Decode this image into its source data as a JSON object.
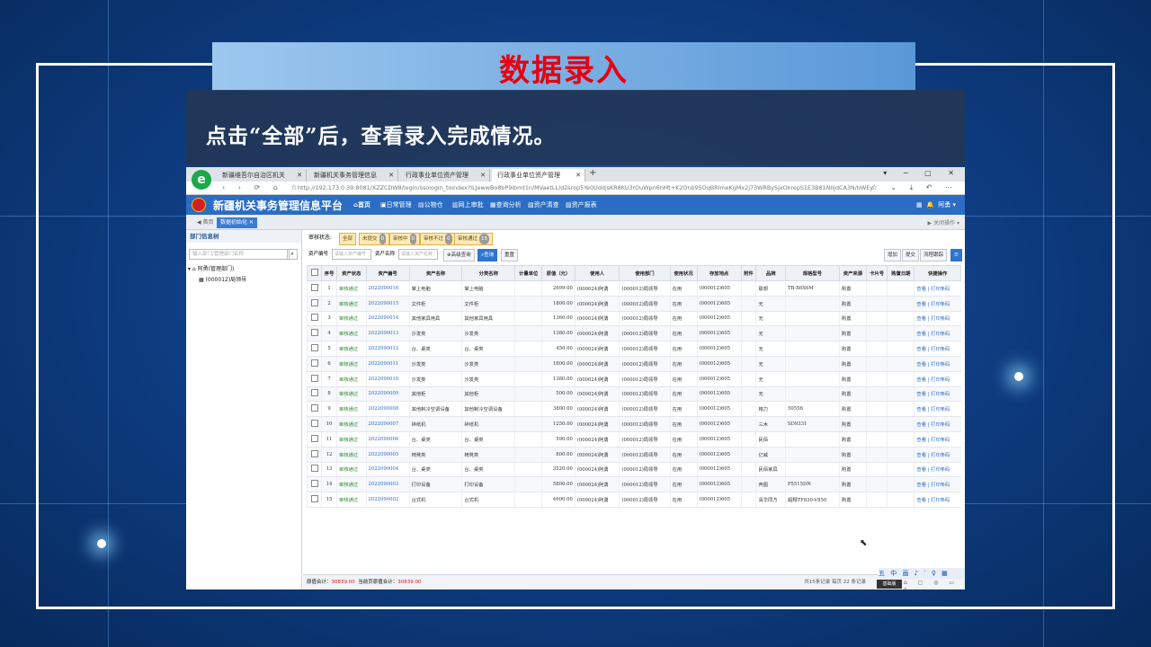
{
  "slide": {
    "banner_title": "数据录入",
    "caption": "点击“全部”后，查看录入完成情况。"
  },
  "browser": {
    "tabs": [
      {
        "label": "新疆维吾尔自治区机关"
      },
      {
        "label": "新疆机关事务管理信息"
      },
      {
        "label": "行政事业单位资产管理"
      },
      {
        "label": "行政事业单位资产管理"
      }
    ],
    "url": "http://192.173.0.39:8081/XZZCDW8/login/ssologin_toindex?ILJewwBo8bP9ibmt1n/MVaetLL/d2srop5Ye0UddjsKR8KU3rOuWpn6hMt+K2Onb95OqBRImeKgMx2j73WRBySjxOkrepS1E3B81NIIjdCA3N/bWEygAnOw=="
  },
  "app": {
    "title": "新疆机关事务管理信息平台",
    "menu": [
      "首页",
      "日常管理",
      "公物仓",
      "网上审批",
      "查询分析",
      "资产清查",
      "资产报表"
    ],
    "user": "阿勇",
    "page_tabs": {
      "home": "首页",
      "current": "数据初始化"
    },
    "page_tabs_right": "关闭操作"
  },
  "left_pane": {
    "title": "部门信息树",
    "search_placeholder": "输入部门/管理部门名称",
    "tree_root": "阿勇(管理部门)",
    "tree_child": "(000012)局领导"
  },
  "filters": {
    "status_label": "审核状态:",
    "chips": [
      {
        "label": "全部",
        "count": ""
      },
      {
        "label": "未提交",
        "count": "0"
      },
      {
        "label": "审核中",
        "count": "0"
      },
      {
        "label": "审核不过",
        "count": "0"
      },
      {
        "label": "审核通过",
        "count": "15"
      }
    ],
    "asset_no_label": "资产编号",
    "asset_no_placeholder": "请输入资产编号",
    "asset_name_label": "资产名称",
    "asset_name_placeholder": "请输入资产名称",
    "adv_query": "高级查询",
    "query": "查询",
    "reset": "重置",
    "right_buttons": [
      "增加",
      "提交",
      "流程跟踪"
    ]
  },
  "table": {
    "headers": [
      "序号",
      "资产状态",
      "资产编号",
      "资产名称",
      "分类名称",
      "计量单位",
      "原值（元）",
      "使用人",
      "使用部门",
      "使用状况",
      "存放地点",
      "附件",
      "品牌",
      "规格型号",
      "资产来源",
      "卡片号",
      "购置日期",
      "快捷操作"
    ],
    "rows": [
      {
        "no": "1",
        "status": "审核通过",
        "code": "2022090016",
        "name": "掌上电脑",
        "cat": "掌上电脑",
        "unit": "",
        "value": "2699.00",
        "user": "(000024)阿勇",
        "dept": "(000012)局领导",
        "cond": "在用",
        "place": "(000012)605",
        "att": "",
        "brand": "联想",
        "model": "TB-X6X6M",
        "src": "购置",
        "card": "",
        "date": "",
        "ops": "查看 | 打印条码"
      },
      {
        "no": "2",
        "status": "审核通过",
        "code": "2022090015",
        "name": "文件柜",
        "cat": "文件柜",
        "unit": "",
        "value": "1800.00",
        "user": "(000024)阿勇",
        "dept": "(000012)局领导",
        "cond": "在用",
        "place": "(000012)605",
        "att": "",
        "brand": "无",
        "model": "",
        "src": "购置",
        "card": "",
        "date": "",
        "ops": "查看 | 打印条码"
      },
      {
        "no": "3",
        "status": "审核通过",
        "code": "2022090014",
        "name": "其他家具用具",
        "cat": "其他家具用具",
        "unit": "",
        "value": "1360.00",
        "user": "(000024)阿勇",
        "dept": "(000012)局领导",
        "cond": "在用",
        "place": "(000012)605",
        "att": "",
        "brand": "无",
        "model": "",
        "src": "购置",
        "card": "",
        "date": "",
        "ops": "查看 | 打印条码"
      },
      {
        "no": "4",
        "status": "审核通过",
        "code": "2022090013",
        "name": "沙发类",
        "cat": "沙发类",
        "unit": "",
        "value": "1380.00",
        "user": "(000024)阿勇",
        "dept": "(000012)局领导",
        "cond": "在用",
        "place": "(000012)605",
        "att": "",
        "brand": "无",
        "model": "",
        "src": "购置",
        "card": "",
        "date": "",
        "ops": "查看 | 打印条码"
      },
      {
        "no": "5",
        "status": "审核通过",
        "code": "2022090012",
        "name": "台、桌类",
        "cat": "台、桌类",
        "unit": "",
        "value": "450.00",
        "user": "(000024)阿勇",
        "dept": "(000012)局领导",
        "cond": "在用",
        "place": "(000012)605",
        "att": "",
        "brand": "无",
        "model": "",
        "src": "购置",
        "card": "",
        "date": "",
        "ops": "查看 | 打印条码"
      },
      {
        "no": "6",
        "status": "审核通过",
        "code": "2022090011",
        "name": "沙发类",
        "cat": "沙发类",
        "unit": "",
        "value": "1800.00",
        "user": "(000024)阿勇",
        "dept": "(000012)局领导",
        "cond": "在用",
        "place": "(000012)605",
        "att": "",
        "brand": "无",
        "model": "",
        "src": "购置",
        "card": "",
        "date": "",
        "ops": "查看 | 打印条码"
      },
      {
        "no": "7",
        "status": "审核通过",
        "code": "2022090010",
        "name": "沙发类",
        "cat": "沙发类",
        "unit": "",
        "value": "1380.00",
        "user": "(000024)阿勇",
        "dept": "(000012)局领导",
        "cond": "在用",
        "place": "(000012)605",
        "att": "",
        "brand": "无",
        "model": "",
        "src": "购置",
        "card": "",
        "date": "",
        "ops": "查看 | 打印条码"
      },
      {
        "no": "8",
        "status": "审核通过",
        "code": "2022090009",
        "name": "其他柜",
        "cat": "其他柜",
        "unit": "",
        "value": "500.00",
        "user": "(000024)阿勇",
        "dept": "(000012)局领导",
        "cond": "在用",
        "place": "(000012)605",
        "att": "",
        "brand": "无",
        "model": "",
        "src": "购置",
        "card": "",
        "date": "",
        "ops": "查看 | 打印条码"
      },
      {
        "no": "9",
        "status": "审核通过",
        "code": "2022090008",
        "name": "其他制冷空调设备",
        "cat": "其他制冷空调设备",
        "unit": "",
        "value": "3800.00",
        "user": "(000024)阿勇",
        "dept": "(000012)局领导",
        "cond": "在用",
        "place": "(000012)605",
        "att": "",
        "brand": "格力",
        "model": "50556",
        "src": "购置",
        "card": "",
        "date": "",
        "ops": "查看 | 打印条码"
      },
      {
        "no": "10",
        "status": "审核通过",
        "code": "2022090007",
        "name": "碎纸机",
        "cat": "碎纸机",
        "unit": "",
        "value": "1250.00",
        "user": "(000024)阿勇",
        "dept": "(000012)局领导",
        "cond": "在用",
        "place": "(000012)605",
        "att": "",
        "brand": "三木",
        "model": "SD9331",
        "src": "购置",
        "card": "",
        "date": "",
        "ops": "查看 | 打印条码"
      },
      {
        "no": "11",
        "status": "审核通过",
        "code": "2022090006",
        "name": "台、桌类",
        "cat": "台、桌类",
        "unit": "",
        "value": "590.00",
        "user": "(000024)阿勇",
        "dept": "(000012)局领导",
        "cond": "在用",
        "place": "(000012)605",
        "att": "",
        "brand": "民佰",
        "model": "",
        "src": "购置",
        "card": "",
        "date": "",
        "ops": "查看 | 打印条码"
      },
      {
        "no": "12",
        "status": "审核通过",
        "code": "2022090005",
        "name": "椅凳类",
        "cat": "椅凳类",
        "unit": "",
        "value": "800.00",
        "user": "(000024)阿勇",
        "dept": "(000012)局领导",
        "cond": "在用",
        "place": "(000012)605",
        "att": "",
        "brand": "亿威",
        "model": "",
        "src": "购置",
        "card": "",
        "date": "",
        "ops": "查看 | 打印条码"
      },
      {
        "no": "13",
        "status": "审核通过",
        "code": "2022090004",
        "name": "台、桌类",
        "cat": "台、桌类",
        "unit": "",
        "value": "3520.00",
        "user": "(000024)阿勇",
        "dept": "(000012)局领导",
        "cond": "在用",
        "place": "(000012)605",
        "att": "",
        "brand": "民佰家具",
        "model": "",
        "src": "购置",
        "card": "",
        "date": "",
        "ops": "查看 | 打印条码"
      },
      {
        "no": "14",
        "status": "审核通过",
        "code": "2022090003",
        "name": "打印设备",
        "cat": "打印设备",
        "unit": "",
        "value": "5800.00",
        "user": "(000024)阿勇",
        "dept": "(000012)局领导",
        "cond": "在用",
        "place": "(000012)605",
        "att": "",
        "brand": "奔图",
        "model": "P5515DN",
        "src": "购置",
        "card": "",
        "date": "",
        "ops": "查看 | 打印条码"
      },
      {
        "no": "15",
        "status": "审核通过",
        "code": "2022090002",
        "name": "台式机",
        "cat": "台式机",
        "unit": "",
        "value": "4600.00",
        "user": "(000024)阿勇",
        "dept": "(000012)局领导",
        "cond": "在用",
        "place": "(000012)605",
        "att": "",
        "brand": "清华同方",
        "model": "超翔TF830-V850",
        "src": "购置",
        "card": "",
        "date": "",
        "ops": "查看 | 打印条码"
      }
    ]
  },
  "footer": {
    "total_label": "原值合计：",
    "total_value": "30839.00",
    "page_total_label": "当前页原值合计：",
    "page_total_value": "30839.00",
    "paging": "共15条记录 每页 22 条记录"
  },
  "ime": {
    "bar": "五 中 画 ♪ ʿ ♀ ▦",
    "label": "基础版"
  }
}
